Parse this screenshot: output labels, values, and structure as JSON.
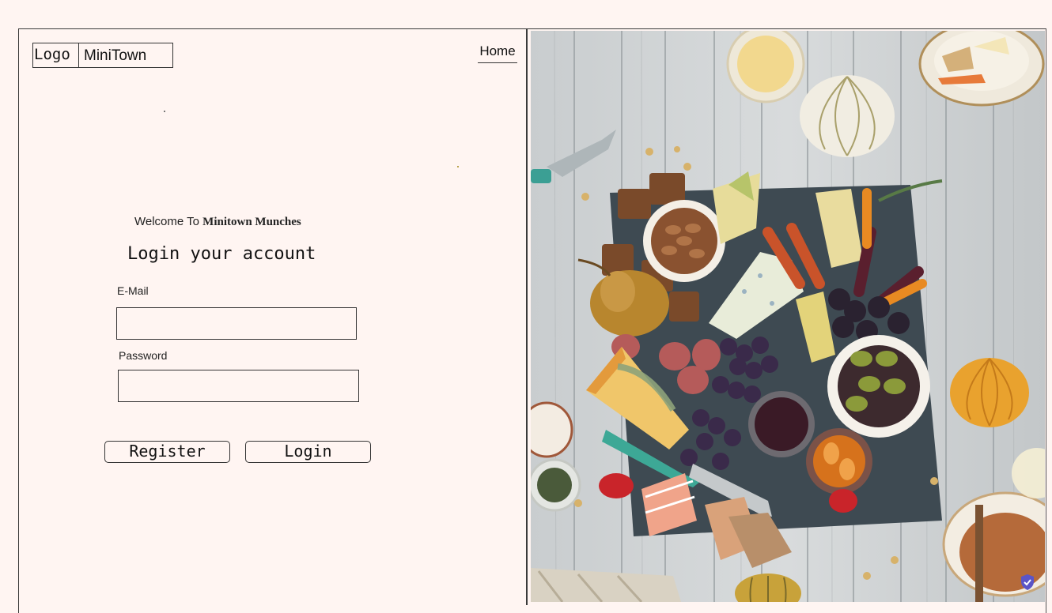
{
  "header": {
    "logo_label": "Logo",
    "site_name": "MiniTown",
    "nav_home": "Home"
  },
  "login": {
    "welcome_prefix": "Welcome To ",
    "welcome_brand": "Minitown Munches",
    "heading": "Login your account",
    "email_label": "E-Mail",
    "email_value": "",
    "password_label": "Password",
    "password_value": "",
    "register_label": "Register",
    "login_label": "Login"
  },
  "colors": {
    "page_background": "#fff5f2",
    "border": "#333333",
    "wood_background": "#cfd3d4"
  },
  "image": {
    "subject": "food-platter-photo"
  },
  "icons": {
    "badge": "shield-check-icon"
  }
}
